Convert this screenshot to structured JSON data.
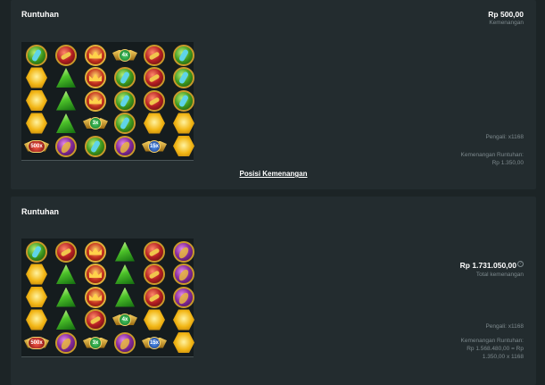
{
  "round1": {
    "title": "Runtuhan",
    "win_amount": "Rp 500,00",
    "win_label": "Kemenangan",
    "multiplier_label": "Pengali: x1168",
    "cascade_label": "Kemenangan Runtuhan:",
    "cascade_value": "Rp 1.350,00",
    "link": "Posisi Kemenangan",
    "grid": [
      [
        "green",
        "red",
        "crown",
        "m:4x:green",
        "red",
        "green"
      ],
      [
        "yhex",
        "tri",
        "crown",
        "green",
        "red",
        "green"
      ],
      [
        "yhex",
        "tri",
        "crown",
        "green",
        "red",
        "green"
      ],
      [
        "yhex",
        "tri",
        "m:3x:green",
        "green",
        "yhex",
        "yhex"
      ],
      [
        "m:500x:red",
        "purple",
        "green",
        "purple",
        "m:15x:blue",
        "yhex"
      ]
    ]
  },
  "round2": {
    "title": "Runtuhan",
    "total_amount": "Rp 1.731.050,00",
    "total_label": "Total kemenangan",
    "info_icon": "?",
    "multiplier_label": "Pengali: x1168",
    "cascade_label": "Kemenangan Runtuhan:",
    "cascade_line1": "Rp 1.568.480,00 = Rp",
    "cascade_line2": "1.350,00 x 1168",
    "grid": [
      [
        "green",
        "red",
        "crown",
        "tri",
        "red",
        "purple"
      ],
      [
        "yhex",
        "tri",
        "crown",
        "tri",
        "red",
        "purple"
      ],
      [
        "yhex",
        "tri",
        "crown",
        "tri",
        "red",
        "purple"
      ],
      [
        "yhex",
        "tri",
        "red",
        "m:4x:green",
        "yhex",
        "yhex"
      ],
      [
        "m:500x:red",
        "purple",
        "m:3x:green",
        "purple",
        "m:15x:blue",
        "yhex"
      ]
    ]
  },
  "colors": {
    "background": "#1c2426",
    "panel": "#232c2f",
    "muted_text": "#7d898d"
  }
}
